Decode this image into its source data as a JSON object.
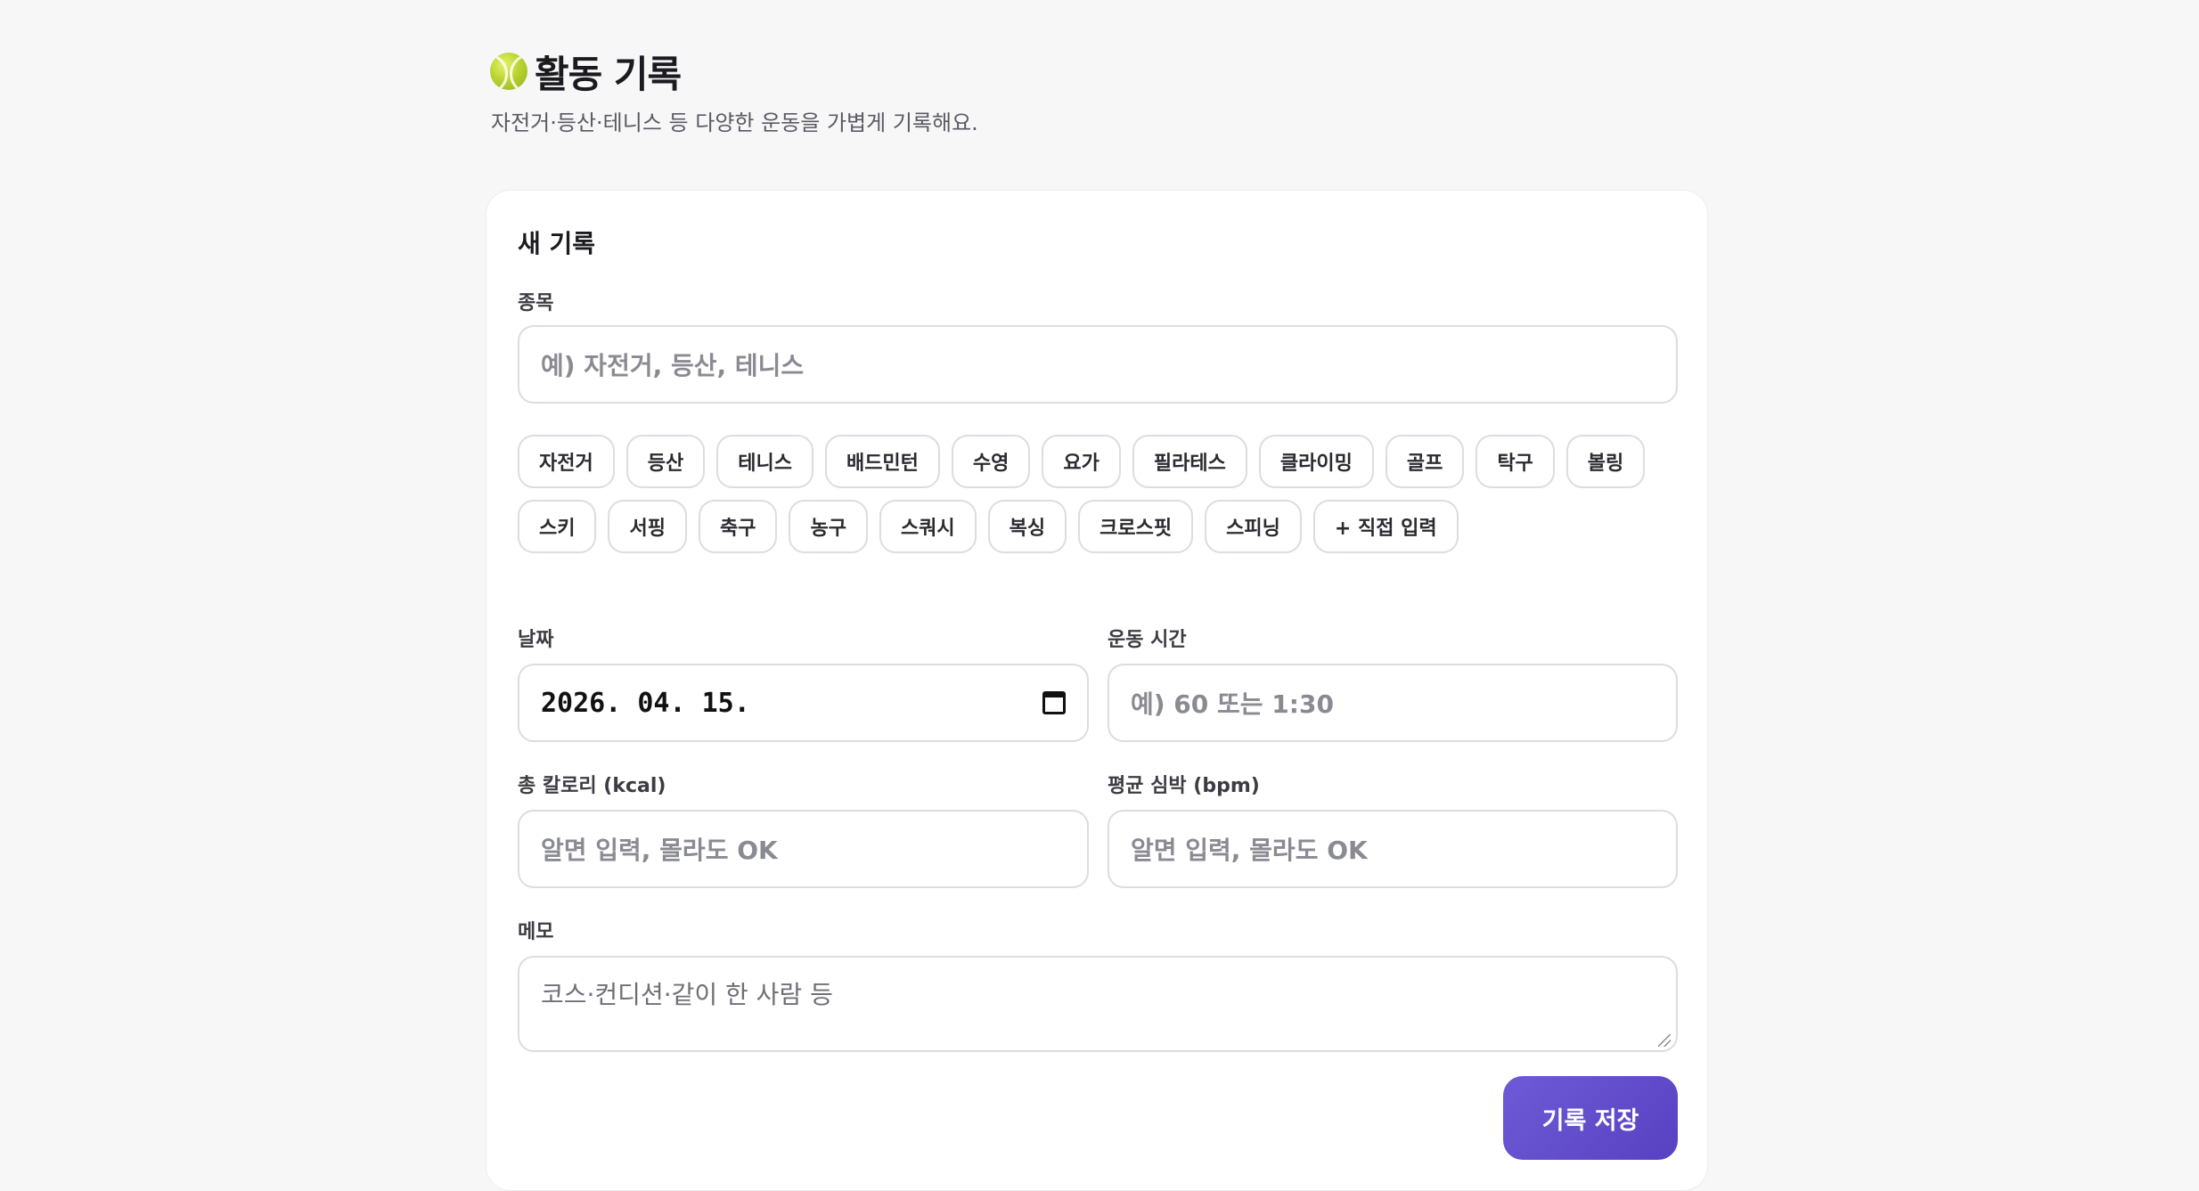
{
  "header": {
    "title": "활동 기록",
    "subtitle": "자전거·등산·테니스 등 다양한 운동을 가볍게 기록해요."
  },
  "form": {
    "card_title": "새 기록",
    "sport": {
      "label": "종목",
      "placeholder": "예) 자전거, 등산, 테니스"
    },
    "sport_chips": [
      "자전거",
      "등산",
      "테니스",
      "배드민턴",
      "수영",
      "요가",
      "필라테스",
      "클라이밍",
      "골프",
      "탁구",
      "볼링",
      "스키",
      "서핑",
      "축구",
      "농구",
      "스쿼시",
      "복싱",
      "크로스핏",
      "스피닝",
      "+ 직접 입력"
    ],
    "date": {
      "label": "날짜",
      "value": "2026. 04. 15."
    },
    "duration": {
      "label": "운동 시간",
      "placeholder": "예) 60 또는 1:30"
    },
    "calories": {
      "label": "총 칼로리 (kcal)",
      "placeholder": "알면 입력, 몰라도 OK"
    },
    "heart_rate": {
      "label": "평균 심박 (bpm)",
      "placeholder": "알면 입력, 몰라도 OK"
    },
    "memo": {
      "label": "메모",
      "placeholder": "코스·컨디션·같이 한 사람 등"
    },
    "save_label": "기록 저장"
  },
  "icons": {
    "title_icon": "tennis-ball-icon",
    "date_icon": "calendar-icon"
  },
  "colors": {
    "accent": "#6150cc",
    "background": "#f7f7f8",
    "card": "#ffffff"
  }
}
